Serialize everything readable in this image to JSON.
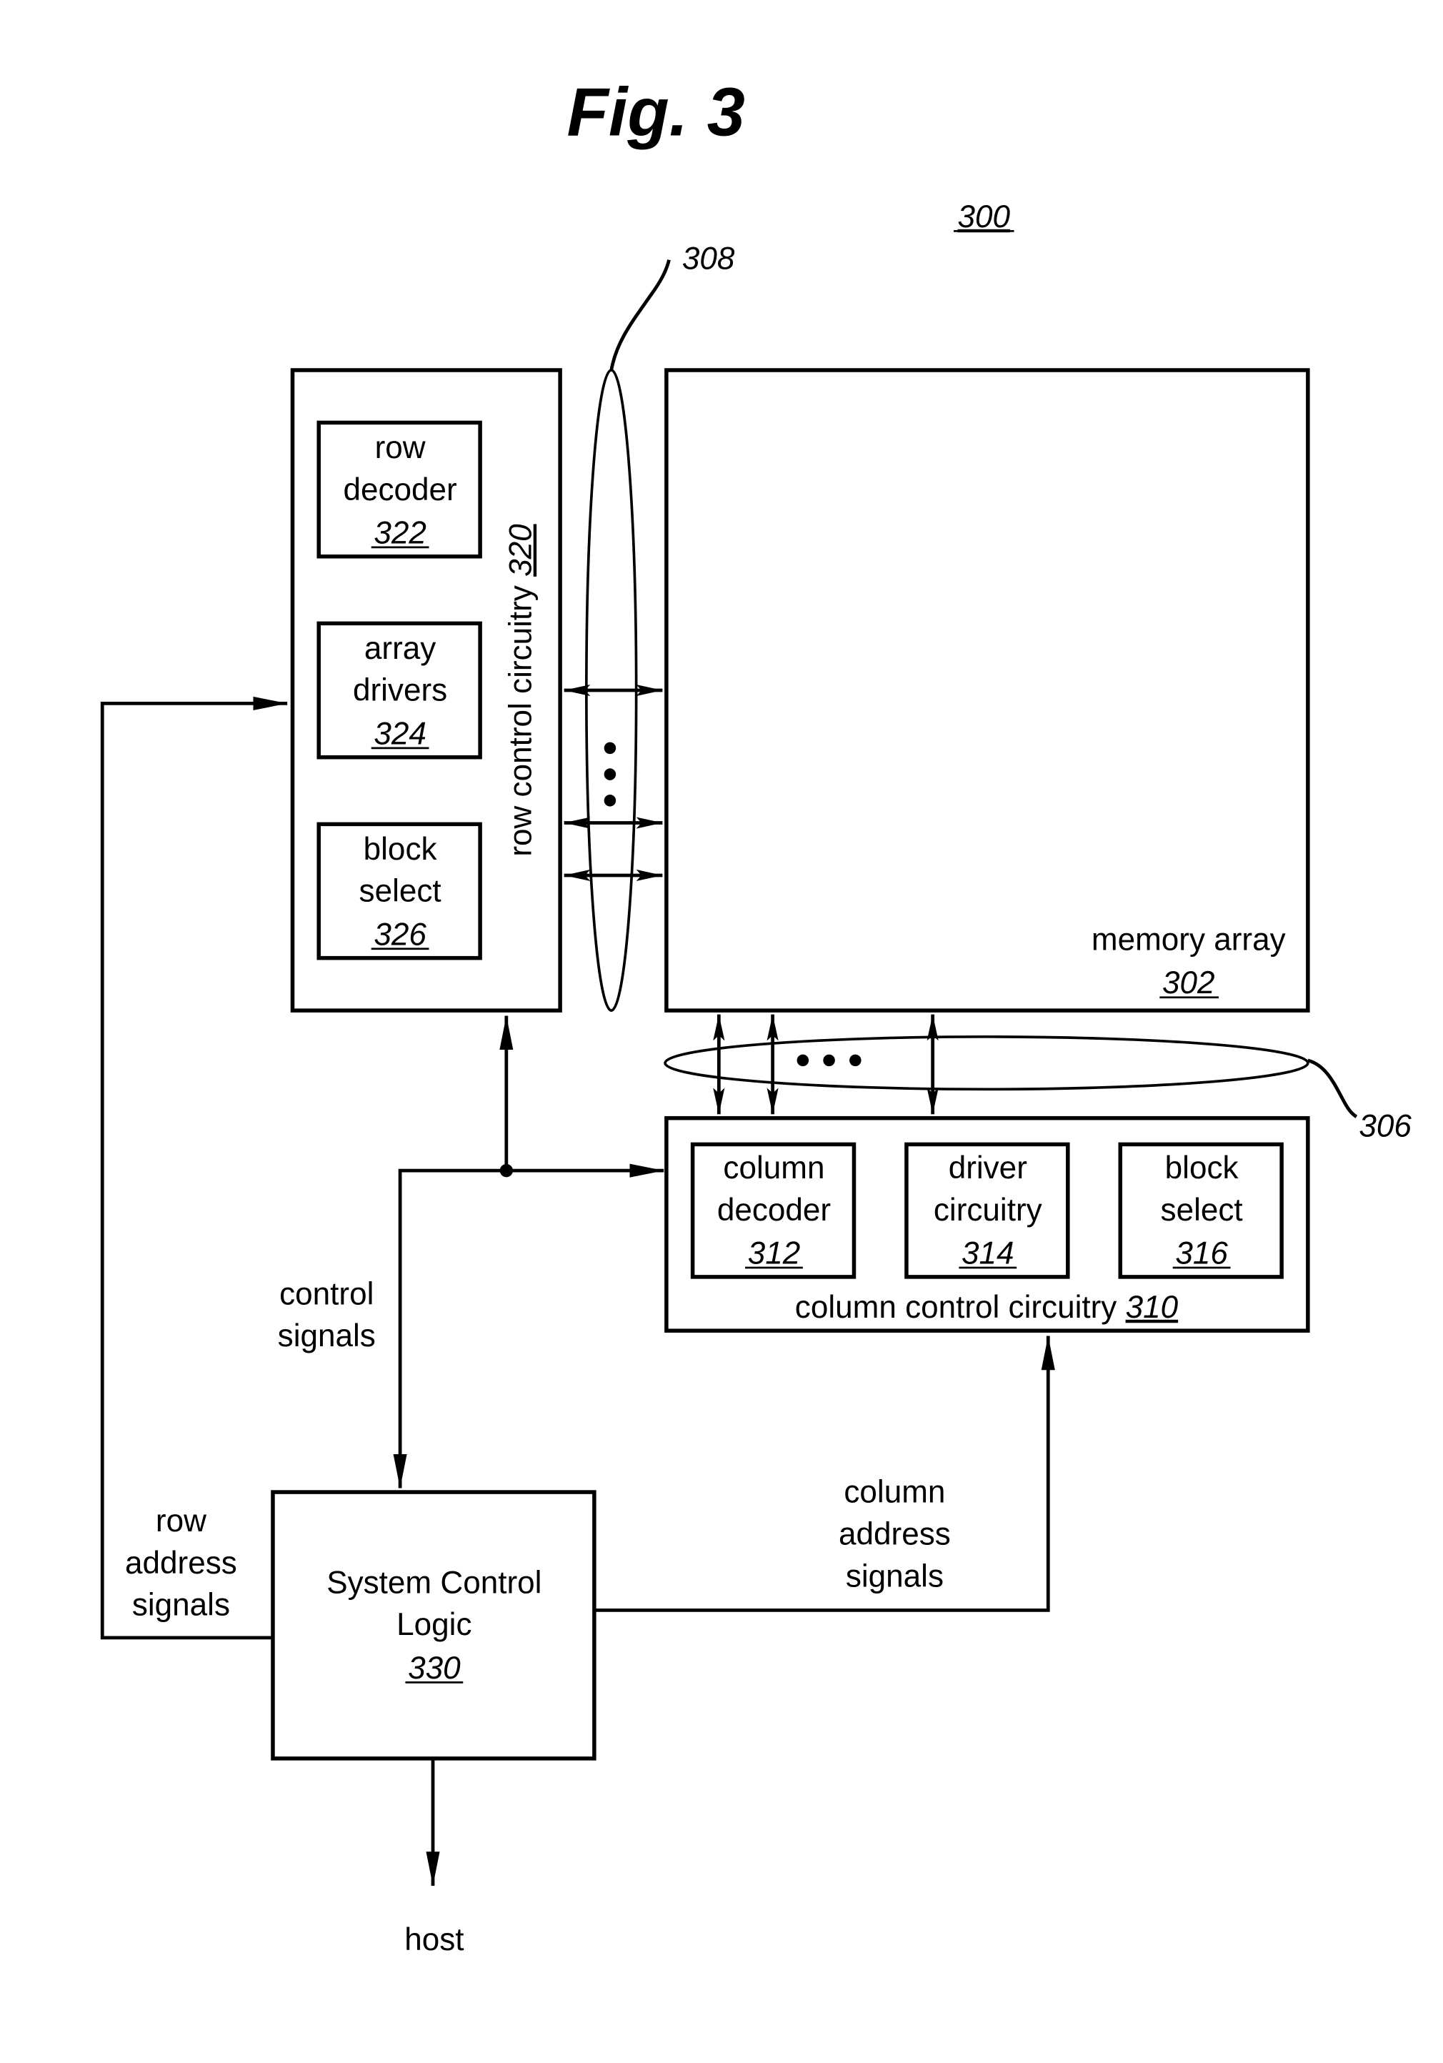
{
  "figure": {
    "title": "Fig. 3",
    "reference": "300"
  },
  "blocks": {
    "memory_array": {
      "label": "memory array",
      "ref": "302"
    },
    "row_control": {
      "label": "row control circuitry ",
      "ref": "320"
    },
    "row_decoder": {
      "line1": "row",
      "line2": "decoder",
      "ref": "322"
    },
    "array_drivers": {
      "line1": "array",
      "line2": "drivers",
      "ref": "324"
    },
    "row_block_select": {
      "line1": "block",
      "line2": "select",
      "ref": "326"
    },
    "column_control": {
      "label": "column control circuitry ",
      "ref": "310"
    },
    "column_decoder": {
      "line1": "column",
      "line2": "decoder",
      "ref": "312"
    },
    "driver_circuitry": {
      "line1": "driver",
      "line2": "circuitry",
      "ref": "314"
    },
    "col_block_select": {
      "line1": "block",
      "line2": "select",
      "ref": "316"
    },
    "system_control": {
      "line1": "System Control",
      "line2": "Logic",
      "ref": "330"
    }
  },
  "buses": {
    "row_bus_ref": "308",
    "column_bus_ref": "306"
  },
  "signals": {
    "control": {
      "line1": "control",
      "line2": "signals"
    },
    "row_address": {
      "line1": "row",
      "line2": "address",
      "line3": "signals"
    },
    "column_address": {
      "line1": "column",
      "line2": "address",
      "line3": "signals"
    },
    "host": "host"
  }
}
